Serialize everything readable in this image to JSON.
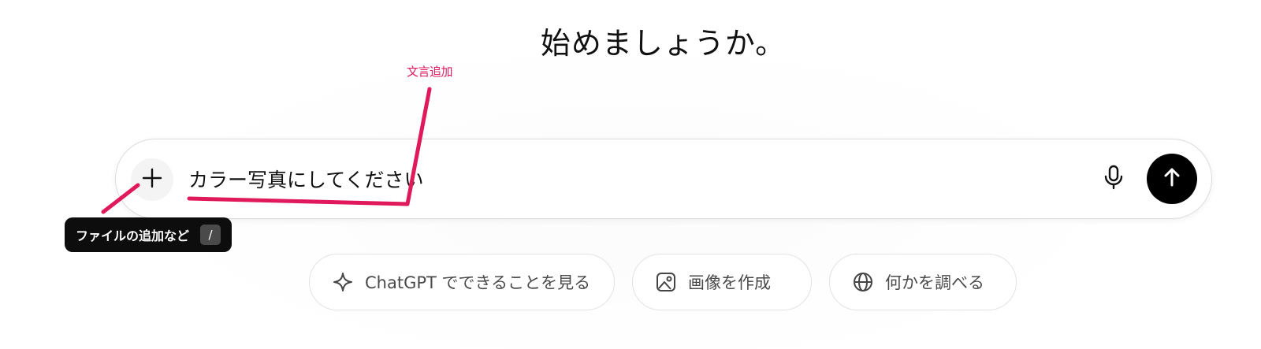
{
  "greeting": {
    "title": "始めましょうか。"
  },
  "composer": {
    "input_value": "カラー写真にしてください",
    "plus_icon": "plus-icon",
    "mic_icon": "microphone-icon",
    "send_icon": "arrow-up-icon"
  },
  "tooltip": {
    "label": "ファイルの追加など",
    "shortcut": "/"
  },
  "annotation": {
    "label": "文言追加",
    "color": "#e0195b"
  },
  "suggestions": [
    {
      "label": "ChatGPT でできることを見る",
      "icon": "sparkle-icon"
    },
    {
      "label": "画像を作成",
      "icon": "image-icon"
    },
    {
      "label": "何かを調べる",
      "icon": "globe-icon"
    }
  ],
  "colors": {
    "send_button_bg": "#000000",
    "tooltip_bg": "#0d0d0d",
    "annotation": "#e0195b"
  }
}
